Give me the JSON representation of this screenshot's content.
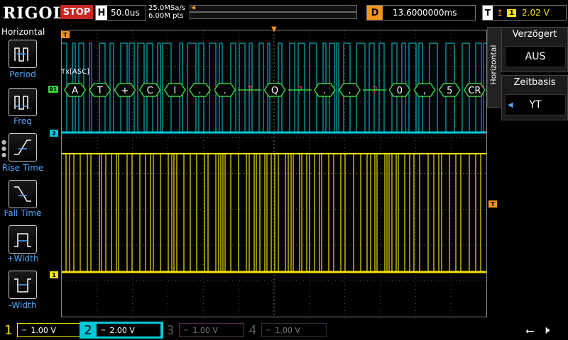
{
  "top": {
    "brand": "RIGOL",
    "run_state": "STOP",
    "h_letter": "H",
    "timebase": "50.0us",
    "sample_rate": "25.0MSa/s",
    "memory_depth": "6.00M pts",
    "delay_letter": "D",
    "delay_value": "13.6000000ms",
    "trigger_letter": "T",
    "trigger_source": "1",
    "trigger_level": "2.02 V"
  },
  "left_menu": {
    "title": "Horizontal",
    "items": [
      "Period",
      "Freq",
      "Rise Time",
      "Fall Time",
      "+Width",
      "-Width"
    ]
  },
  "right_menu": {
    "tab": "Horizontal",
    "cards": [
      {
        "label": "Verzögert",
        "value": "AUS"
      },
      {
        "label": "Zeitbasis",
        "value": "YT"
      }
    ]
  },
  "decode": {
    "label": "Tx[ASC]",
    "marker": "B1",
    "frames": [
      "A",
      "T",
      "+",
      "C",
      "I",
      ".",
      ".",
      "?",
      "Q",
      "?",
      ".",
      ".",
      "?",
      "0",
      ",",
      "5",
      "CR"
    ]
  },
  "markers": {
    "ch1": "1",
    "ch2": "2",
    "trigger": "T",
    "trig_pos": "T"
  },
  "channels": [
    {
      "num": "1",
      "scale": "1.00 V"
    },
    {
      "num": "2",
      "scale": "2.00 V"
    },
    {
      "num": "3",
      "scale": "1.00 V"
    },
    {
      "num": "4",
      "scale": "1.00 V"
    }
  ],
  "colors": {
    "ch1": "#f7e300",
    "ch2": "#00c8d8",
    "accent": "#f7941d",
    "decode_box": "#3ccf3c",
    "error": "#ff2a4a",
    "stop": "#c8261f",
    "menu_label": "#4aa8ff"
  },
  "icons": [
    "usb-icon",
    "speaker-muted-icon"
  ]
}
